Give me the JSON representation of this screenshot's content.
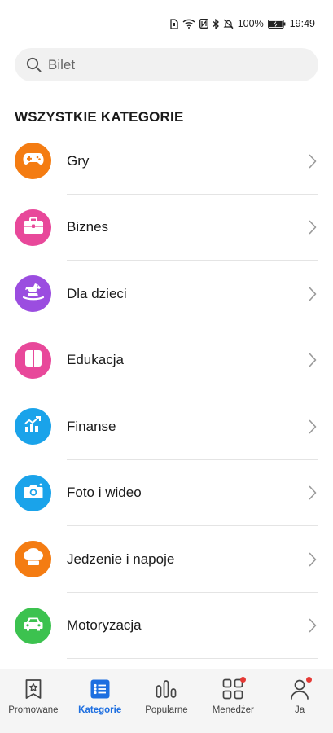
{
  "status_bar": {
    "battery": "100%",
    "time": "19:49",
    "icons": [
      "sim-icon",
      "wifi-icon",
      "nfc-icon",
      "bluetooth-icon",
      "mute-icon",
      "battery-icon"
    ]
  },
  "search": {
    "placeholder": "Bilet",
    "icon": "search-icon"
  },
  "section_title": "WSZYSTKIE KATEGORIE",
  "categories": [
    {
      "label": "Gry",
      "icon": "gamepad-icon",
      "color": "#f47c12"
    },
    {
      "label": "Biznes",
      "icon": "briefcase-icon",
      "color": "#e8489a"
    },
    {
      "label": "Dla dzieci",
      "icon": "rocking-horse-icon",
      "color": "#9b4de0"
    },
    {
      "label": "Edukacja",
      "icon": "book-icon",
      "color": "#e8489a"
    },
    {
      "label": "Finanse",
      "icon": "chart-trend-icon",
      "color": "#1aa3ea"
    },
    {
      "label": "Foto i wideo",
      "icon": "camera-icon",
      "color": "#1aa3ea"
    },
    {
      "label": "Jedzenie i napoje",
      "icon": "chef-hat-icon",
      "color": "#f47c12"
    },
    {
      "label": "Motoryzacja",
      "icon": "car-icon",
      "color": "#3cc24f"
    }
  ],
  "bottom_nav": {
    "items": [
      {
        "label": "Promowane",
        "icon": "star-bookmark-icon",
        "active": false,
        "badge": false
      },
      {
        "label": "Kategorie",
        "icon": "list-icon",
        "active": true,
        "badge": false
      },
      {
        "label": "Popularne",
        "icon": "bars-icon",
        "active": false,
        "badge": false
      },
      {
        "label": "Menedżer",
        "icon": "grid-icon",
        "active": false,
        "badge": true
      },
      {
        "label": "Ja",
        "icon": "person-icon",
        "active": false,
        "badge": true
      }
    ],
    "active_color": "#1e6fe0",
    "badge_color": "#e53935"
  }
}
